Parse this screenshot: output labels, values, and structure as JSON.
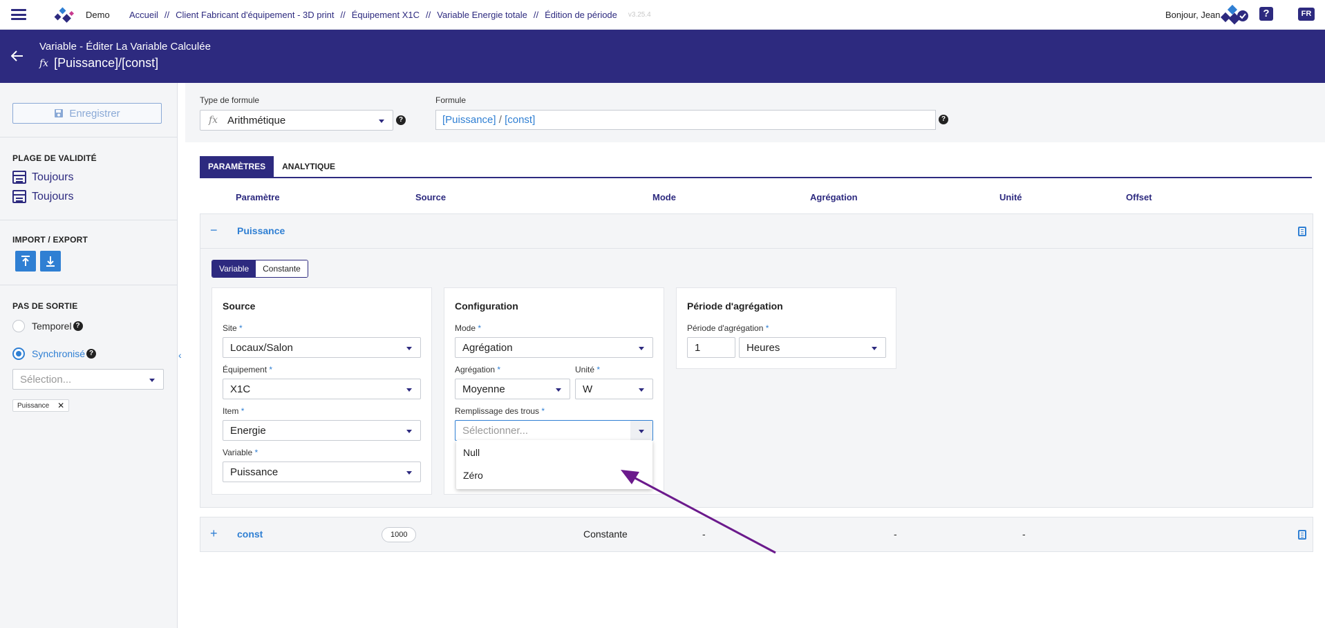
{
  "topbar": {
    "brand": "Demo",
    "breadcrumbs": [
      "Accueil",
      "Client Fabricant d'équipement - 3D print",
      "Équipement X1C",
      "Variable Energie totale",
      "Édition de période"
    ],
    "separator": "//",
    "version": "v3.25.4",
    "greeting": "Bonjour, Jean",
    "help": "?",
    "language": "FR"
  },
  "header": {
    "subtitle": "Variable - Éditer La Variable Calculée",
    "title": "[Puissance]/[const]",
    "fx_symbol": "fx"
  },
  "sidebar": {
    "save_label": "Enregistrer",
    "validity_heading": "PLAGE DE VALIDITÉ",
    "validity_items": [
      "Toujours",
      "Toujours"
    ],
    "import_export_heading": "IMPORT / EXPORT",
    "output_step_heading": "PAS DE SORTIE",
    "radio_options": [
      {
        "label": "Temporel",
        "checked": false
      },
      {
        "label": "Synchronisé",
        "checked": true
      }
    ],
    "select_placeholder": "Sélection...",
    "tag_label": "Puissance",
    "help": "?"
  },
  "formula": {
    "type_label": "Type de formule",
    "type_value": "Arithmétique",
    "formula_label": "Formule",
    "formula_tokens": [
      "[Puissance]",
      "/",
      "[const]"
    ],
    "help": "?"
  },
  "tabs": [
    {
      "label": "PARAMÈTRES",
      "active": true
    },
    {
      "label": "ANALYTIQUE",
      "active": false
    }
  ],
  "columns": [
    "Paramètre",
    "Source",
    "Mode",
    "Agrégation",
    "Unité",
    "Offset"
  ],
  "params": [
    {
      "name": "Puissance",
      "expanded": true,
      "toggle": "−",
      "segmented": [
        "Variable",
        "Constante"
      ],
      "source_card": {
        "title": "Source",
        "fields": [
          {
            "label": "Site",
            "value": "Locaux/Salon"
          },
          {
            "label": "Équipement",
            "value": "X1C"
          },
          {
            "label": "Item",
            "value": "Energie"
          },
          {
            "label": "Variable",
            "value": "Puissance"
          }
        ]
      },
      "config_card": {
        "title": "Configuration",
        "mode_label": "Mode",
        "mode_value": "Agrégation",
        "aggregation_label": "Agrégation",
        "aggregation_value": "Moyenne",
        "unit_label": "Unité",
        "unit_value": "W",
        "gap_fill_label": "Remplissage des trous",
        "gap_fill_placeholder": "Sélectionner...",
        "gap_fill_options": [
          "Null",
          "Zéro"
        ]
      },
      "period_card": {
        "title": "Période d'agrégation",
        "label": "Période d'agrégation",
        "count": "1",
        "unit": "Heures"
      }
    },
    {
      "name": "const",
      "expanded": false,
      "toggle": "+",
      "value": "1000",
      "mode": "Constante",
      "aggregation": "-",
      "unit": "-",
      "offset": "-"
    }
  ],
  "required_marker": "*",
  "colors": {
    "primary": "#2d2a7f",
    "accent": "#2f7fd3",
    "annotation_arrow": "#6b1a8c"
  }
}
